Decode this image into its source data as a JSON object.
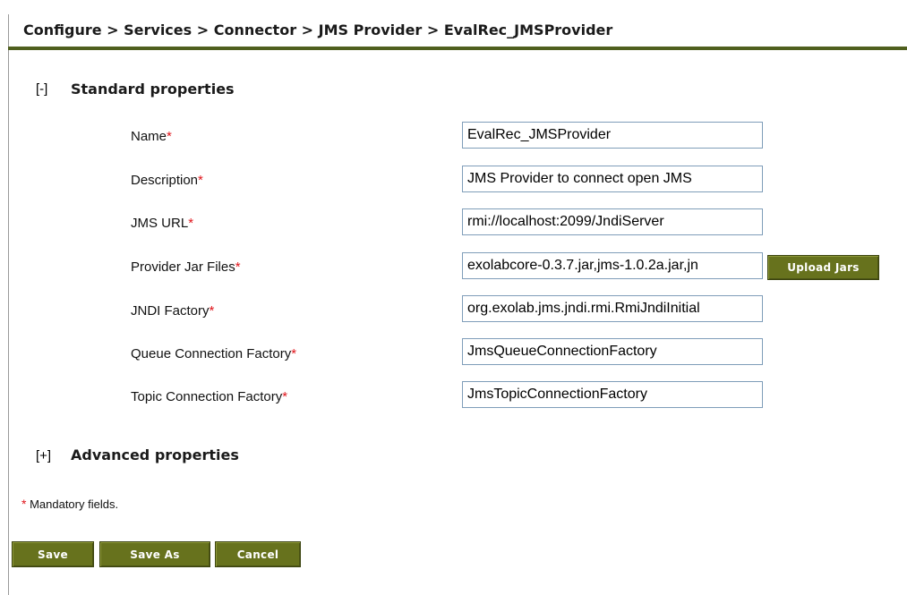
{
  "breadcrumb": "Configure > Services > Connector > JMS Provider > EvalRec_JMSProvider",
  "standard": {
    "toggle": "[-]",
    "title": "Standard properties",
    "fields": [
      {
        "label": "Name",
        "value": "EvalRec_JMSProvider"
      },
      {
        "label": "Description",
        "value": "JMS Provider to connect open JMS"
      },
      {
        "label": "JMS URL",
        "value": "rmi://localhost:2099/JndiServer"
      },
      {
        "label": "Provider Jar Files",
        "value": "exolabcore-0.3.7.jar,jms-1.0.2a.jar,jn"
      },
      {
        "label": "JNDI Factory",
        "value": "org.exolab.jms.jndi.rmi.RmiJndiInitial"
      },
      {
        "label": "Queue Connection Factory",
        "value": "JmsQueueConnectionFactory"
      },
      {
        "label": "Topic Connection Factory",
        "value": "JmsTopicConnectionFactory"
      }
    ],
    "required_marker": "*",
    "upload_button": "Upload Jars"
  },
  "advanced": {
    "toggle": "[+]",
    "title": "Advanced properties"
  },
  "mandatory_note": {
    "marker": "*",
    "text": " Mandatory fields."
  },
  "buttons": {
    "save": "Save",
    "save_as": "Save As",
    "cancel": "Cancel"
  },
  "colors": {
    "accent": "#67721d",
    "header_rule": "#4f5f1e",
    "required": "#e0151b"
  }
}
